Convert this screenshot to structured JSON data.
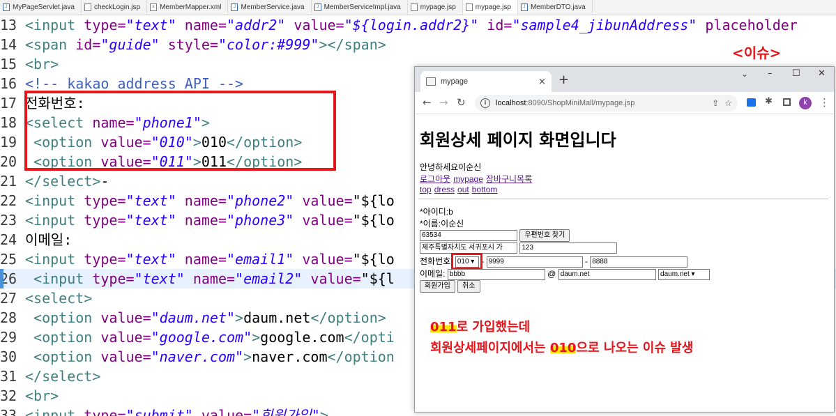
{
  "editor_tabs": [
    "MyPageServlet.java",
    "checkLogin.jsp",
    "MemberMapper.xml",
    "MemberService.java",
    "MemberServiceImpl.java",
    "mypage.jsp",
    "mypage.jsp",
    "MemberDTO.java"
  ],
  "code": {
    "l13": {
      "n": "13",
      "tag": "<input ",
      "a1": "type=",
      "v1": "\"text\"",
      "a2": " name=",
      "v2": "\"addr2\"",
      "a3": " value=",
      "v3": "\"${login.addr2}\"",
      "a4": " id=",
      "v4": "\"sample4_jibunAddress\"",
      "a5": " placeholder"
    },
    "l14": {
      "n": "14",
      "tag": "<span ",
      "a1": "id=",
      "v1": "\"guide\"",
      "a2": " style=",
      "v2": "\"color:#999\"",
      "end": "></span>"
    },
    "l15": {
      "n": "15",
      "tag": "<br>"
    },
    "l16": {
      "n": "16",
      "comment": "<!-- kakao address API -->"
    },
    "l17": {
      "n": "17",
      "text": "전화번호:"
    },
    "l18": {
      "n": "18",
      "tag": "<select ",
      "a1": "name=",
      "v1": "\"phone1\"",
      "end": ">"
    },
    "l19": {
      "n": "19",
      "tag": " <option ",
      "a1": "value=",
      "v1": "\"010\"",
      "end": ">",
      "text": "010",
      "close": "</option>"
    },
    "l20": {
      "n": "20",
      "tag": " <option ",
      "a1": "value=",
      "v1": "\"011\"",
      "end": ">",
      "text": "011",
      "close": "</option>"
    },
    "l21": {
      "n": "21",
      "tag": "</select>",
      "text": "-"
    },
    "l22": {
      "n": "22",
      "tag": "<input ",
      "a1": "type=",
      "v1": "\"text\"",
      "a2": " name=",
      "v2": "\"phone2\"",
      "a3": " value=",
      "text": "\"${lo"
    },
    "l23": {
      "n": "23",
      "tag": "<input ",
      "a1": "type=",
      "v1": "\"text\"",
      "a2": " name=",
      "v2": "\"phone3\"",
      "a3": " value=",
      "text": "\"${lo"
    },
    "l24": {
      "n": "24",
      "text": "이메일:"
    },
    "l25": {
      "n": "25",
      "tag": "<input ",
      "a1": "type=",
      "v1": "\"text\"",
      "a2": " name=",
      "v2": "\"email1\"",
      "a3": " value=",
      "text": "\"${lo"
    },
    "l26": {
      "n": "26",
      "tag": " <input ",
      "a1": "type=",
      "v1": "\"text\"",
      "a2": " name=",
      "v2": "\"email2\"",
      "a3": " value=",
      "text": "\"${l"
    },
    "l27": {
      "n": "27",
      "tag": "<select>"
    },
    "l28": {
      "n": "28",
      "tag": " <option ",
      "a1": "value=",
      "v1": "\"daum.net\"",
      "end": ">",
      "text": "daum.net",
      "close": "</option>"
    },
    "l29": {
      "n": "29",
      "tag": " <option ",
      "a1": "value=",
      "v1": "\"google.com\"",
      "end": ">",
      "text": "google.com",
      "close": "</opti"
    },
    "l30": {
      "n": "30",
      "tag": " <option ",
      "a1": "value=",
      "v1": "\"naver.com\"",
      "end": ">",
      "text": "naver.com",
      "close": "</option"
    },
    "l31": {
      "n": "31",
      "tag": "</select>"
    },
    "l32": {
      "n": "32",
      "tag": "<br>"
    },
    "l33": {
      "n": "33",
      "tag": "<input ",
      "a1": "type=",
      "v1": "\"submit\"",
      "a2": " value=",
      "v2": "\"회원가입\"",
      "end": ">"
    }
  },
  "issue_label": "<이슈>",
  "browser": {
    "tab_title": "mypage",
    "tab_close": "×",
    "new_tab": "+",
    "chevron": "⌄",
    "min": "–",
    "max": "☐",
    "close": "✕",
    "back": "←",
    "forward": "→",
    "reload": "↻",
    "info": "i",
    "url_host": "localhost",
    "url_rest": ":8090/ShopMiniMall/mypage.jsp",
    "share": "⇪",
    "star": "☆",
    "puzzle": "✱",
    "avatar": "k",
    "kebab": "⋮"
  },
  "page": {
    "title": "회원상세 페이지 화면입니다",
    "greeting": "안녕하세요이순신",
    "links1": [
      "로그아웃",
      "mypage",
      "장바구니목록"
    ],
    "links2": [
      "top",
      "dress",
      "out",
      "bottom"
    ],
    "id_line": "*아이디:b",
    "name_line": "*이름:이순신",
    "postcode": "63534",
    "postcode_btn": "우편번호 찾기",
    "addr1": "제주특별자치도 서귀포시 가",
    "addr2": "123",
    "phone_label": "전화번호:",
    "phone1": "010",
    "phone_sep1": "-",
    "phone2": "9999",
    "phone_sep2": "-",
    "phone3": "8888",
    "email_label": "이메일:",
    "email1": "bbbb",
    "email_at": "@",
    "email2": "daum.net",
    "email_select": "daum.net",
    "join_btn": "회원가입",
    "cancel_btn": "취소"
  },
  "note": {
    "l1_num": "011",
    "l1_rest": "로 가입했는데",
    "l2_pre": "회원상세페이지에서는 ",
    "l2_num": "010",
    "l2_rest": "으로 나오는 이슈 발생"
  }
}
